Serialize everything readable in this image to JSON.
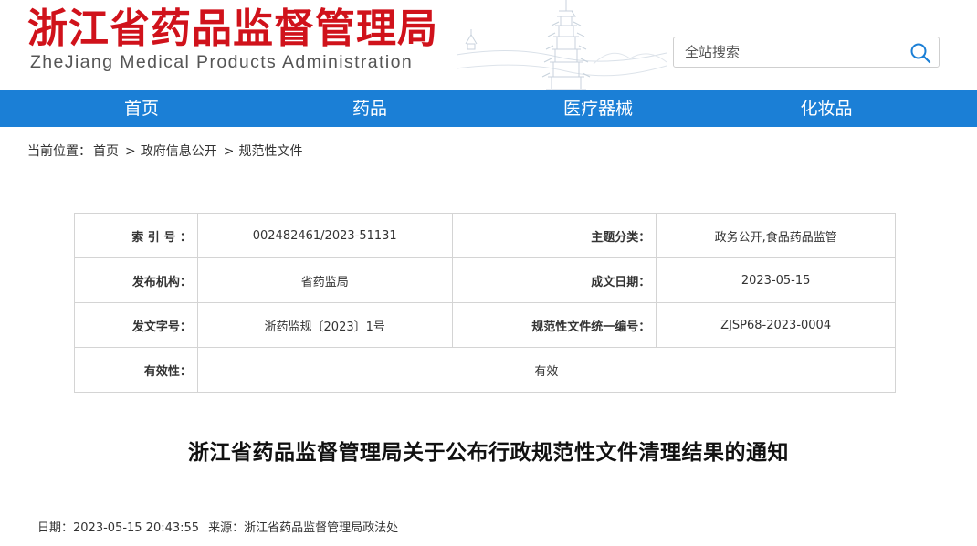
{
  "header": {
    "site_title_cn": "浙江省药品监督管理局",
    "site_title_en": "ZheJiang Medical Products Administration",
    "search_placeholder": "全站搜索"
  },
  "nav": [
    "首页",
    "药品",
    "医疗器械",
    "化妆品"
  ],
  "breadcrumb": {
    "prefix": "当前位置：",
    "items": [
      "首页",
      "政府信息公开",
      "规范性文件"
    ],
    "separator": ">"
  },
  "meta_table": {
    "index_label": "索 引 号 ：",
    "index_value": "002482461/2023-51131",
    "topic_label": "主题分类：",
    "topic_value": "政务公开,食品药品监管",
    "issuer_label": "发布机构：",
    "issuer_value": "省药监局",
    "date_label": "成文日期：",
    "date_value": "2023-05-15",
    "docno_label": "发文字号：",
    "docno_value": "浙药监规〔2023〕1号",
    "unified_label": "规范性文件统一编号：",
    "unified_value": "ZJSP68-2023-0004",
    "validity_label": "有效性：",
    "validity_value": "有效"
  },
  "article": {
    "title": "浙江省药品监督管理局关于公布行政规范性文件清理结果的通知",
    "date_text": "日期：2023-05-15 20:43:55",
    "source_text": "来源：浙江省药品监督管理局政法处"
  },
  "colors": {
    "brand_red": "#d0121b",
    "nav_blue": "#1b7fd6"
  }
}
